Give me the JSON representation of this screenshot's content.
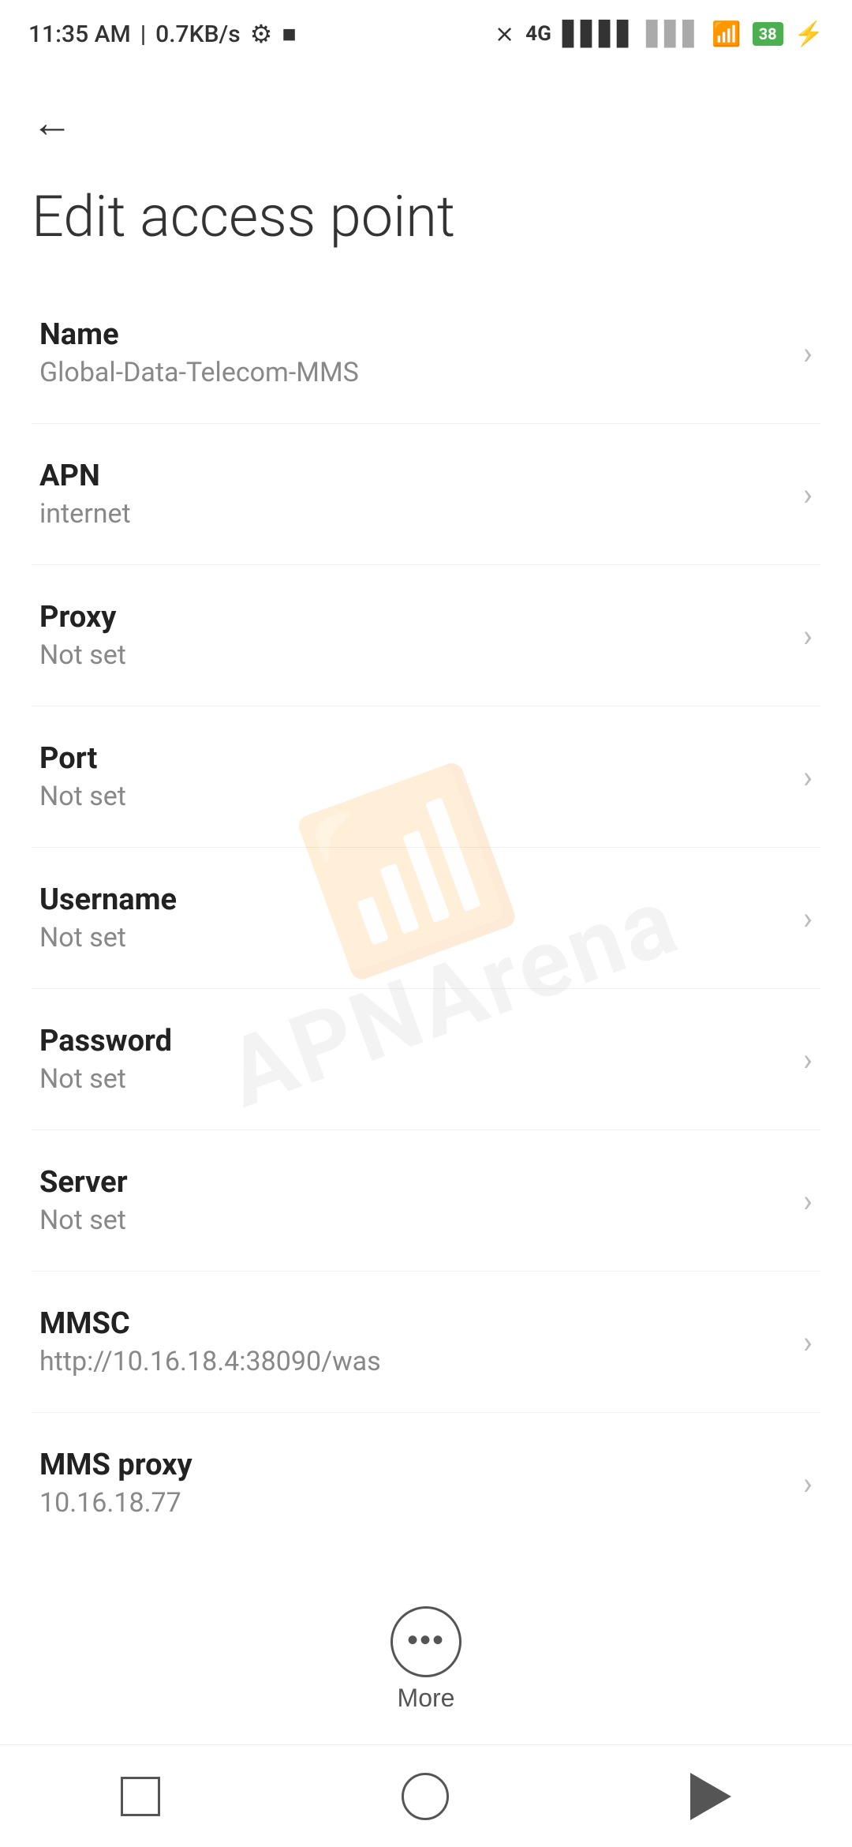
{
  "statusBar": {
    "time": "11:35 AM",
    "speed": "0.7KB/s",
    "battery": "38"
  },
  "header": {
    "back_label": "←"
  },
  "pageTitle": "Edit access point",
  "settings": [
    {
      "label": "Name",
      "value": "Global-Data-Telecom-MMS"
    },
    {
      "label": "APN",
      "value": "internet"
    },
    {
      "label": "Proxy",
      "value": "Not set"
    },
    {
      "label": "Port",
      "value": "Not set"
    },
    {
      "label": "Username",
      "value": "Not set"
    },
    {
      "label": "Password",
      "value": "Not set"
    },
    {
      "label": "Server",
      "value": "Not set"
    },
    {
      "label": "MMSC",
      "value": "http://10.16.18.4:38090/was"
    },
    {
      "label": "MMS proxy",
      "value": "10.16.18.77"
    }
  ],
  "more": {
    "label": "More"
  },
  "watermark": {
    "text": "APNArena"
  }
}
